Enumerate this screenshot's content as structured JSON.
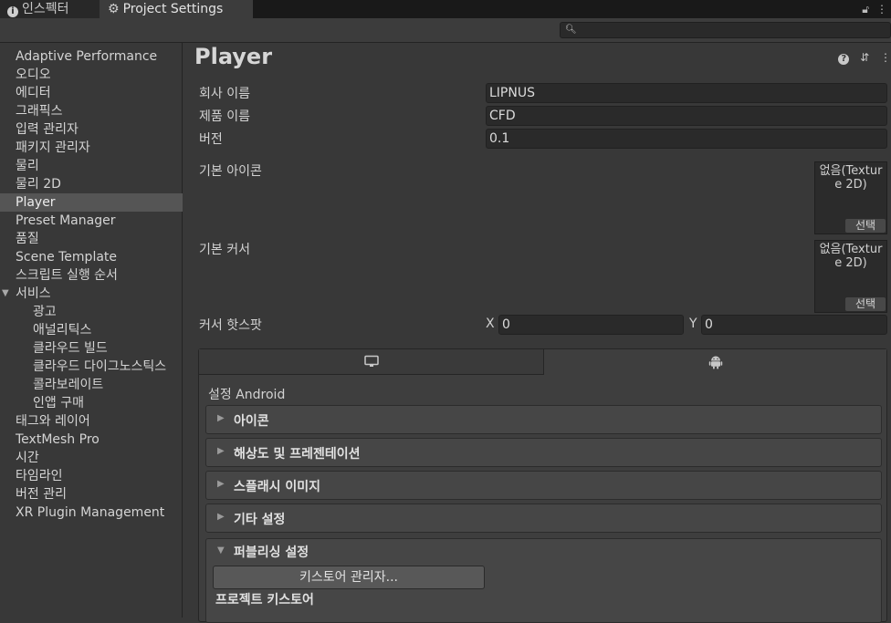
{
  "tabs": {
    "inspector": "인스펙터",
    "project_settings": "Project Settings"
  },
  "search": {
    "placeholder": ""
  },
  "sidebar": {
    "items": [
      {
        "label": "Adaptive Performance"
      },
      {
        "label": "오디오"
      },
      {
        "label": "에디터"
      },
      {
        "label": "그래픽스"
      },
      {
        "label": "입력 관리자"
      },
      {
        "label": "패키지 관리자"
      },
      {
        "label": "물리"
      },
      {
        "label": "물리 2D"
      },
      {
        "label": "Player"
      },
      {
        "label": "Preset Manager"
      },
      {
        "label": "품질"
      },
      {
        "label": "Scene Template"
      },
      {
        "label": "스크립트 실행 순서"
      },
      {
        "label": "서비스"
      },
      {
        "label": "광고"
      },
      {
        "label": "애널리틱스"
      },
      {
        "label": "클라우드 빌드"
      },
      {
        "label": "클라우드 다이그노스틱스"
      },
      {
        "label": "콜라보레이트"
      },
      {
        "label": "인앱 구매"
      },
      {
        "label": "태그와 레이어"
      },
      {
        "label": "TextMesh Pro"
      },
      {
        "label": "시간"
      },
      {
        "label": "타임라인"
      },
      {
        "label": "버전 관리"
      },
      {
        "label": "XR Plugin Management"
      }
    ],
    "selected": "Player"
  },
  "main": {
    "title": "Player",
    "company_label": "회사 이름",
    "company_value": "LIPNUS",
    "product_label": "제품 이름",
    "product_value": "CFD",
    "version_label": "버전",
    "version_value": "0.1",
    "default_icon_label": "기본 아이콘",
    "default_cursor_label": "기본 커서",
    "object_none_line1": "없음(Textur",
    "object_none_line2": "e 2D)",
    "select_label": "선택",
    "hotspot_label": "커서 핫스팟",
    "hotspot_x_label": "X",
    "hotspot_x_value": "0",
    "hotspot_y_label": "Y",
    "hotspot_y_value": "0"
  },
  "platform": {
    "settings_title": "설정 Android",
    "sections": [
      "아이콘",
      "해상도 및 프레젠테이션",
      "스플래시 이미지",
      "기타 설정"
    ],
    "publishing_label": "퍼블리싱 설정",
    "keystore_manager_button": "키스토어 관리자...",
    "project_keystore_label": "프로젝트 키스토어"
  }
}
